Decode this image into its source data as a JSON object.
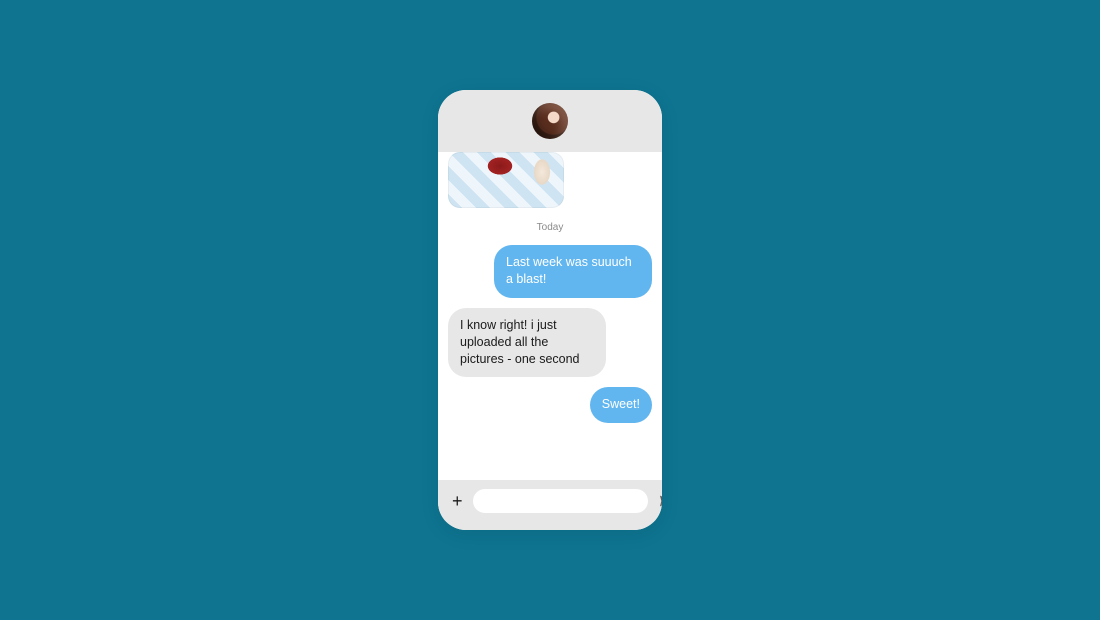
{
  "header": {
    "avatar_name": "contact-avatar"
  },
  "messages": {
    "timestamp": "Today",
    "attachment_desc": "photo-attachment",
    "items": [
      {
        "side": "sent",
        "text": "Last week was suuuch a blast!"
      },
      {
        "side": "recv",
        "text": "I know right! i just uploaded all the pictures - one second"
      },
      {
        "side": "sent",
        "text": "Sweet!"
      }
    ]
  },
  "composer": {
    "placeholder": "",
    "value": ""
  },
  "colors": {
    "background": "#0e7490",
    "sent_bubble": "#62b6f0",
    "recv_bubble": "#e7e7e7"
  }
}
